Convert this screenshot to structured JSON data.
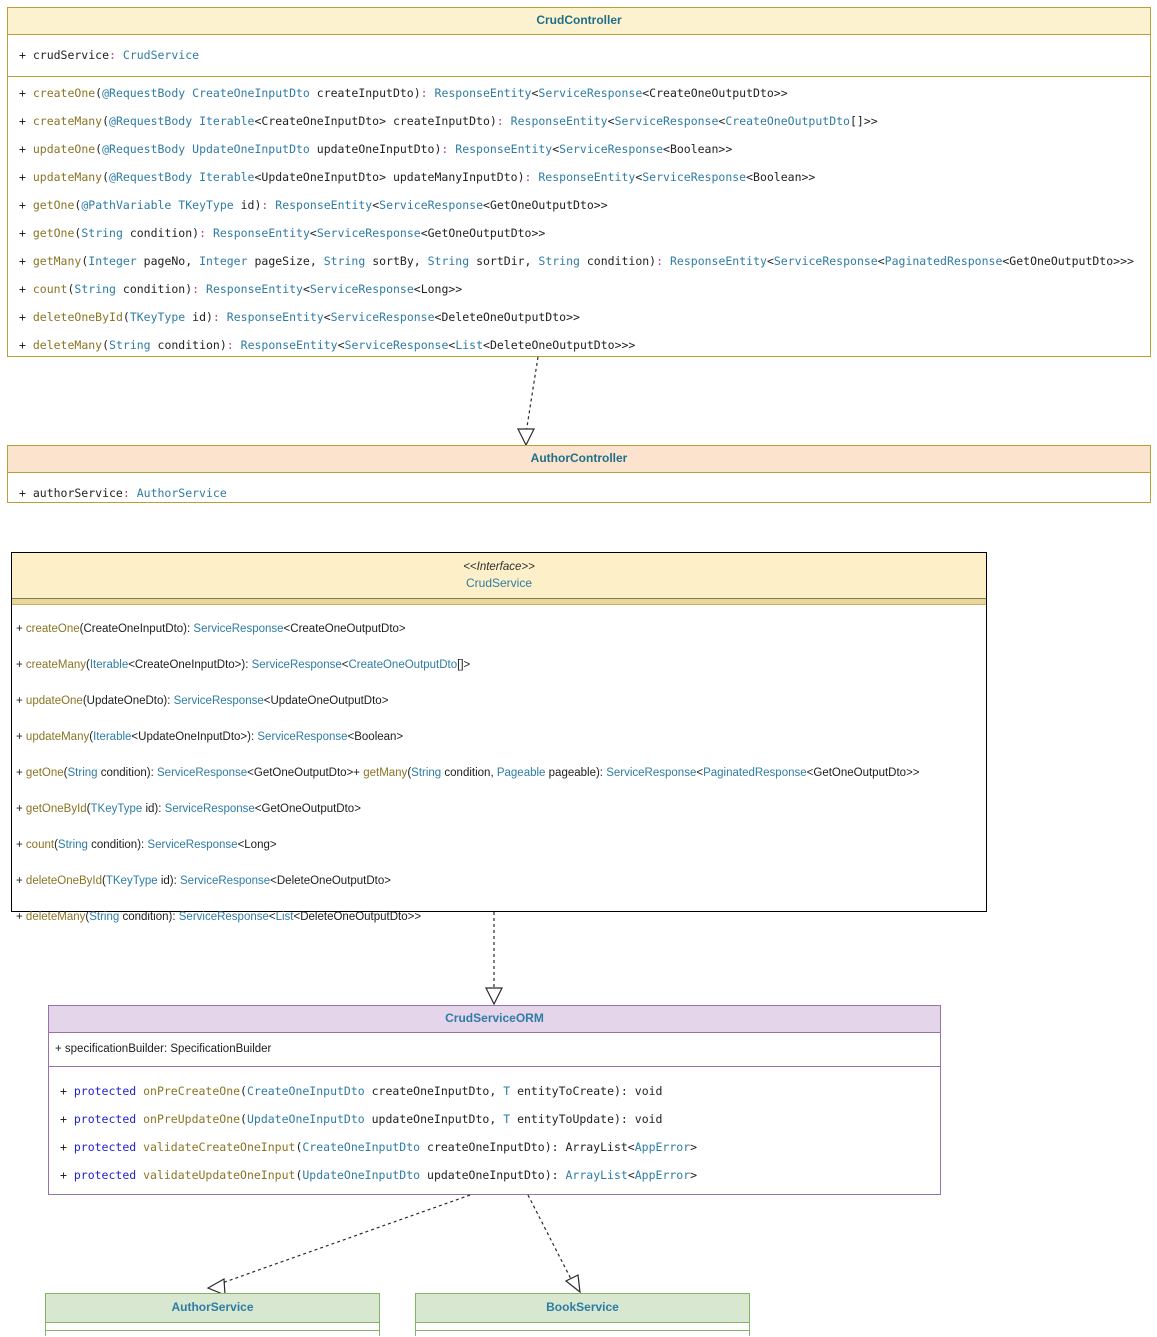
{
  "diagram": {
    "title": "UML Class Diagram",
    "colors": {
      "controller_border": "#b8a038",
      "controller_header": "#fdf2cf",
      "controller_header_alt": "#fbe3cd",
      "interface_border": "#000000",
      "interface_header": "#fdf0c8",
      "orm_border": "#9673a6",
      "orm_header": "#e5d5ea",
      "service_border": "#82b366",
      "service_header": "#d8e8d0",
      "class_title_text": "#2e7ca5",
      "type_text": "#2e7ca5",
      "method_text": "#8a7424",
      "keyword_text": "#2222cc"
    }
  },
  "crud_controller": {
    "title": "CrudController",
    "attributes": [
      "+ crudService: CrudService"
    ],
    "operations": [
      "+ createOne(@RequestBody CreateOneInputDto createInputDto): ResponseEntity<ServiceResponse<CreateOneOutputDto>>",
      "+ createMany(@RequestBody Iterable<CreateOneInputDto> createInputDto): ResponseEntity<ServiceResponse<CreateOneOutputDto[]>>",
      "+ updateOne(@RequestBody UpdateOneInputDto updateOneInputDto): ResponseEntity<ServiceResponse<Boolean>>",
      "+ updateMany(@RequestBody Iterable<UpdateOneInputDto> updateManyInputDto): ResponseEntity<ServiceResponse<Boolean>>",
      "+ getOne(@PathVariable TKeyType id): ResponseEntity<ServiceResponse<GetOneOutputDto>>",
      "+ getOne(String condition): ResponseEntity<ServiceResponse<GetOneOutputDto>>",
      "+ getMany(Integer pageNo, Integer pageSize, String sortBy, String sortDir, String condition): ResponseEntity<ServiceResponse<PaginatedResponse<GetOneOutputDto>>>",
      "+ count(String condition): ResponseEntity<ServiceResponse<Long>>",
      "+ deleteOneById(TKeyType id): ResponseEntity<ServiceResponse<DeleteOneOutputDto>>",
      "+ deleteMany(String condition): ResponseEntity<ServiceResponse<List<DeleteOneOutputDto>>>"
    ]
  },
  "author_controller": {
    "title": "AuthorController",
    "attributes": [
      "+ authorService: AuthorService"
    ]
  },
  "crud_service": {
    "stereotype": "<<Interface>>",
    "title": "CrudService",
    "operations": [
      "+ createOne(CreateOneInputDto): ServiceResponse<CreateOneOutputDto>",
      "+ createMany(Iterable<CreateOneInputDto>): ServiceResponse<CreateOneOutputDto[]>",
      "+ updateOne(UpdateOneDto): ServiceResponse<UpdateOneOutputDto>",
      "+ updateMany(Iterable<UpdateOneInputDto>): ServiceResponse<Boolean>",
      "+ getOne(String condition): ServiceResponse<GetOneOutputDto>+ getMany(String condition, Pageable pageable): ServiceResponse<PaginatedResponse<GetOneOutputDto>>",
      "+ getOneById(TKeyType id): ServiceResponse<GetOneOutputDto>",
      "+ count(String condition): ServiceResponse<Long>",
      "+ deleteOneById(TKeyType id): ServiceResponse<DeleteOneOutputDto>",
      "+ deleteMany(String condition): ServiceResponse<List<DeleteOneOutputDto>>"
    ]
  },
  "crud_service_orm": {
    "title": "CrudServiceORM",
    "attributes": [
      "+ specificationBuilder: SpecificationBuilder"
    ],
    "operations": [
      "+ protected onPreCreateOne(CreateOneInputDto createOneInputDto, T entityToCreate): void",
      "+ protected onPreUpdateOne(UpdateOneInputDto updateOneInputDto, T entityToUpdate): void",
      "+ protected validateCreateOneInput(CreateOneInputDto createOneInputDto): ArrayList<AppError>",
      "+ protected validateUpdateOneInput(UpdateOneInputDto updateOneInputDto): ArrayList<AppError>"
    ]
  },
  "author_service": {
    "title": "AuthorService"
  },
  "book_service": {
    "title": "BookService"
  },
  "relationships": [
    {
      "name": "crudcontroller-to-authorcontroller",
      "type": "realization-dashed-hollow-triangle"
    },
    {
      "name": "crudservice-to-crudserviceorm",
      "type": "realization-dashed-hollow-triangle"
    },
    {
      "name": "crudserviceorm-to-authorservice",
      "type": "realization-dashed-hollow-triangle"
    },
    {
      "name": "crudserviceorm-to-bookservice",
      "type": "realization-dashed-hollow-triangle"
    }
  ]
}
